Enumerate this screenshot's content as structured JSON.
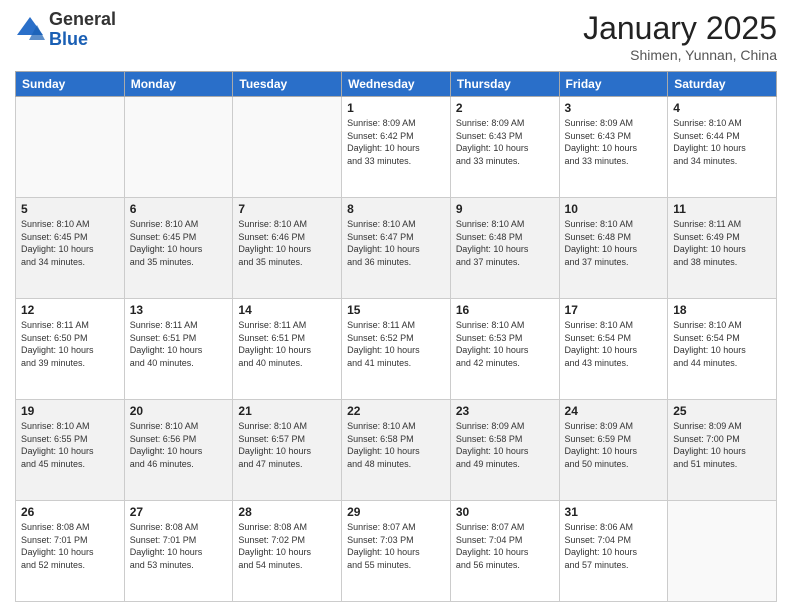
{
  "header": {
    "logo_general": "General",
    "logo_blue": "Blue",
    "month_title": "January 2025",
    "location": "Shimen, Yunnan, China"
  },
  "days_of_week": [
    "Sunday",
    "Monday",
    "Tuesday",
    "Wednesday",
    "Thursday",
    "Friday",
    "Saturday"
  ],
  "weeks": [
    [
      {
        "day": "",
        "info": ""
      },
      {
        "day": "",
        "info": ""
      },
      {
        "day": "",
        "info": ""
      },
      {
        "day": "1",
        "info": "Sunrise: 8:09 AM\nSunset: 6:42 PM\nDaylight: 10 hours\nand 33 minutes."
      },
      {
        "day": "2",
        "info": "Sunrise: 8:09 AM\nSunset: 6:43 PM\nDaylight: 10 hours\nand 33 minutes."
      },
      {
        "day": "3",
        "info": "Sunrise: 8:09 AM\nSunset: 6:43 PM\nDaylight: 10 hours\nand 33 minutes."
      },
      {
        "day": "4",
        "info": "Sunrise: 8:10 AM\nSunset: 6:44 PM\nDaylight: 10 hours\nand 34 minutes."
      }
    ],
    [
      {
        "day": "5",
        "info": "Sunrise: 8:10 AM\nSunset: 6:45 PM\nDaylight: 10 hours\nand 34 minutes."
      },
      {
        "day": "6",
        "info": "Sunrise: 8:10 AM\nSunset: 6:45 PM\nDaylight: 10 hours\nand 35 minutes."
      },
      {
        "day": "7",
        "info": "Sunrise: 8:10 AM\nSunset: 6:46 PM\nDaylight: 10 hours\nand 35 minutes."
      },
      {
        "day": "8",
        "info": "Sunrise: 8:10 AM\nSunset: 6:47 PM\nDaylight: 10 hours\nand 36 minutes."
      },
      {
        "day": "9",
        "info": "Sunrise: 8:10 AM\nSunset: 6:48 PM\nDaylight: 10 hours\nand 37 minutes."
      },
      {
        "day": "10",
        "info": "Sunrise: 8:10 AM\nSunset: 6:48 PM\nDaylight: 10 hours\nand 37 minutes."
      },
      {
        "day": "11",
        "info": "Sunrise: 8:11 AM\nSunset: 6:49 PM\nDaylight: 10 hours\nand 38 minutes."
      }
    ],
    [
      {
        "day": "12",
        "info": "Sunrise: 8:11 AM\nSunset: 6:50 PM\nDaylight: 10 hours\nand 39 minutes."
      },
      {
        "day": "13",
        "info": "Sunrise: 8:11 AM\nSunset: 6:51 PM\nDaylight: 10 hours\nand 40 minutes."
      },
      {
        "day": "14",
        "info": "Sunrise: 8:11 AM\nSunset: 6:51 PM\nDaylight: 10 hours\nand 40 minutes."
      },
      {
        "day": "15",
        "info": "Sunrise: 8:11 AM\nSunset: 6:52 PM\nDaylight: 10 hours\nand 41 minutes."
      },
      {
        "day": "16",
        "info": "Sunrise: 8:10 AM\nSunset: 6:53 PM\nDaylight: 10 hours\nand 42 minutes."
      },
      {
        "day": "17",
        "info": "Sunrise: 8:10 AM\nSunset: 6:54 PM\nDaylight: 10 hours\nand 43 minutes."
      },
      {
        "day": "18",
        "info": "Sunrise: 8:10 AM\nSunset: 6:54 PM\nDaylight: 10 hours\nand 44 minutes."
      }
    ],
    [
      {
        "day": "19",
        "info": "Sunrise: 8:10 AM\nSunset: 6:55 PM\nDaylight: 10 hours\nand 45 minutes."
      },
      {
        "day": "20",
        "info": "Sunrise: 8:10 AM\nSunset: 6:56 PM\nDaylight: 10 hours\nand 46 minutes."
      },
      {
        "day": "21",
        "info": "Sunrise: 8:10 AM\nSunset: 6:57 PM\nDaylight: 10 hours\nand 47 minutes."
      },
      {
        "day": "22",
        "info": "Sunrise: 8:10 AM\nSunset: 6:58 PM\nDaylight: 10 hours\nand 48 minutes."
      },
      {
        "day": "23",
        "info": "Sunrise: 8:09 AM\nSunset: 6:58 PM\nDaylight: 10 hours\nand 49 minutes."
      },
      {
        "day": "24",
        "info": "Sunrise: 8:09 AM\nSunset: 6:59 PM\nDaylight: 10 hours\nand 50 minutes."
      },
      {
        "day": "25",
        "info": "Sunrise: 8:09 AM\nSunset: 7:00 PM\nDaylight: 10 hours\nand 51 minutes."
      }
    ],
    [
      {
        "day": "26",
        "info": "Sunrise: 8:08 AM\nSunset: 7:01 PM\nDaylight: 10 hours\nand 52 minutes."
      },
      {
        "day": "27",
        "info": "Sunrise: 8:08 AM\nSunset: 7:01 PM\nDaylight: 10 hours\nand 53 minutes."
      },
      {
        "day": "28",
        "info": "Sunrise: 8:08 AM\nSunset: 7:02 PM\nDaylight: 10 hours\nand 54 minutes."
      },
      {
        "day": "29",
        "info": "Sunrise: 8:07 AM\nSunset: 7:03 PM\nDaylight: 10 hours\nand 55 minutes."
      },
      {
        "day": "30",
        "info": "Sunrise: 8:07 AM\nSunset: 7:04 PM\nDaylight: 10 hours\nand 56 minutes."
      },
      {
        "day": "31",
        "info": "Sunrise: 8:06 AM\nSunset: 7:04 PM\nDaylight: 10 hours\nand 57 minutes."
      },
      {
        "day": "",
        "info": ""
      }
    ]
  ]
}
